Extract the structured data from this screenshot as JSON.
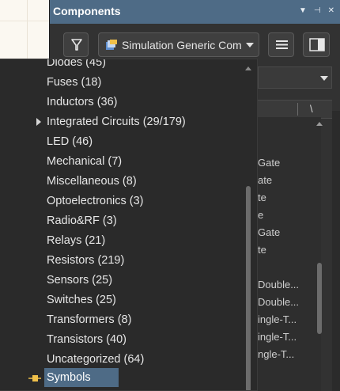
{
  "panel": {
    "title": "Components",
    "library_select": {
      "value": "Simulation Generic Com"
    },
    "table": {
      "column_label": "\\",
      "rows": [
        "Gate",
        "ate",
        "te",
        "e",
        "Gate",
        "te",
        "",
        "Double...",
        "Double...",
        "ingle-T...",
        "ingle-T...",
        "ngle-T..."
      ]
    }
  },
  "dropdown": {
    "items": [
      {
        "label": "Diodes",
        "count": "(45)"
      },
      {
        "label": "Fuses",
        "count": "(18)"
      },
      {
        "label": "Inductors",
        "count": "(36)"
      },
      {
        "label": "Integrated Circuits",
        "count": "(29/179)"
      },
      {
        "label": "LED",
        "count": "(46)"
      },
      {
        "label": "Mechanical",
        "count": "(7)"
      },
      {
        "label": "Miscellaneous",
        "count": "(8)"
      },
      {
        "label": "Optoelectronics",
        "count": "(3)"
      },
      {
        "label": "Radio&RF",
        "count": "(3)"
      },
      {
        "label": "Relays",
        "count": "(21)"
      },
      {
        "label": "Resistors",
        "count": "(219)"
      },
      {
        "label": "Sensors",
        "count": "(25)"
      },
      {
        "label": "Switches",
        "count": "(25)"
      },
      {
        "label": "Transformers",
        "count": "(8)"
      },
      {
        "label": "Transistors",
        "count": "(40)"
      },
      {
        "label": "Uncategorized",
        "count": "(64)"
      }
    ],
    "selected": "Symbols"
  },
  "colors": {
    "accent": "#4e6b86",
    "panel_bg": "#323232",
    "dropdown_bg": "#2a2a2a",
    "text": "#e6e6e6"
  },
  "icons": {
    "pin": "pin-icon",
    "close": "close-icon",
    "menu": "chevron-down-icon",
    "filter": "filter-icon",
    "list": "hamburger-icon",
    "layout": "panel-layout-icon",
    "library": "library-icon",
    "expander": "chevron-right-icon",
    "symbols": "symbol-icon"
  }
}
